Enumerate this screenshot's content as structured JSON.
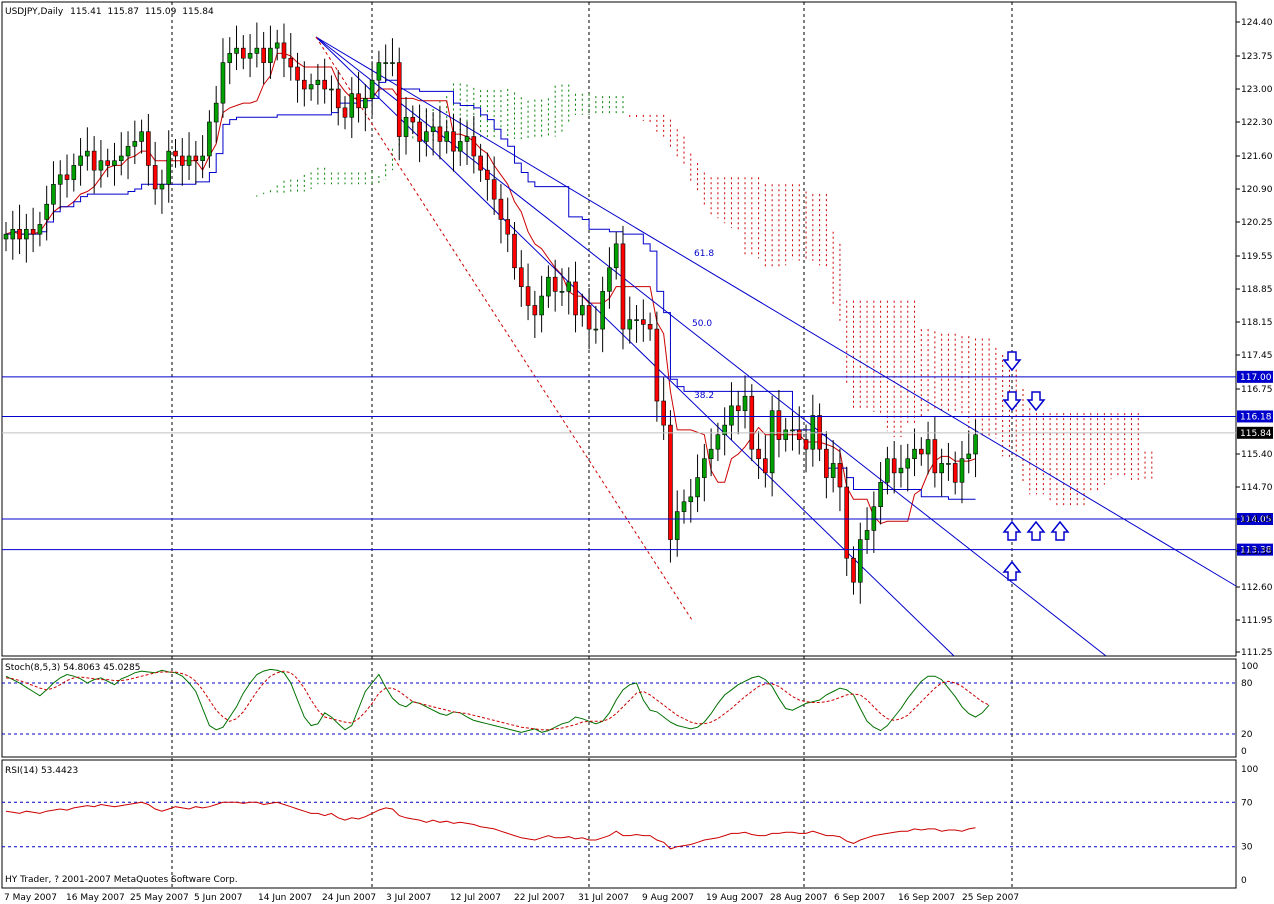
{
  "header": {
    "symbol": "USDJPY,Daily",
    "open": "115.41",
    "high": "115.87",
    "low": "115.09",
    "close": "115.84"
  },
  "colors": {
    "bull": "#00a000",
    "bear": "#ff0000",
    "kijun": "#0000cc",
    "tenkan": "#cc0000",
    "cloud_bear": "#cc0000",
    "cloud_bull": "#008000",
    "level": "#0000cc",
    "price_box": "#000000"
  },
  "chart_data": [
    {
      "type": "candlestick",
      "price_axis": {
        "min": 11.25,
        "max": 124.4,
        "ticks": [
          "124.40",
          "123.75",
          "123.00",
          "122.30",
          "121.60",
          "120.90",
          "120.25",
          "119.55",
          "118.85",
          "118.15",
          "117.45",
          "116.75",
          "115.40",
          "114.70",
          "114.05",
          "113.35",
          "112.60",
          "111.95",
          "111.25"
        ]
      },
      "x_axis_labels": [
        "7 May 2007",
        "16 May 2007",
        "25 May 2007",
        "5 Jun 2007",
        "14 Jun 2007",
        "24 Jun 2007",
        "3 Jul 2007",
        "12 Jul 2007",
        "22 Jul 2007",
        "31 Jul 2007",
        "9 Aug 2007",
        "19 Aug 2007",
        "28 Aug 2007",
        "6 Sep 2007",
        "16 Sep 2007",
        "25 Sep 2007"
      ],
      "levels": [
        {
          "label": "117.00",
          "value": 117.0
        },
        {
          "label": "116.18",
          "value": 116.18
        },
        {
          "label": "114.05",
          "value": 114.05
        },
        {
          "label": "113.38",
          "value": 113.38
        }
      ],
      "current_price": {
        "label": "115.84",
        "value": 115.84
      },
      "fibo_labels": [
        "61.8",
        "50.0",
        "38.2"
      ],
      "closes": [
        120.0,
        120.1,
        119.9,
        120.1,
        120.0,
        120.2,
        120.6,
        121.0,
        121.2,
        121.1,
        121.4,
        121.6,
        121.7,
        121.3,
        121.5,
        121.4,
        121.5,
        121.6,
        121.8,
        121.9,
        122.1,
        121.4,
        120.9,
        121.0,
        121.7,
        121.6,
        121.4,
        121.6,
        121.5,
        121.6,
        122.3,
        122.7,
        123.6,
        123.8,
        123.9,
        123.7,
        123.8,
        123.9,
        123.6,
        123.9,
        124.0,
        123.7,
        123.5,
        123.2,
        123.0,
        123.1,
        123.2,
        123.0,
        123.0,
        122.6,
        122.4,
        122.9,
        122.6,
        122.8,
        123.2,
        123.6,
        123.6,
        123.6,
        122.0,
        122.4,
        122.3,
        121.9,
        122.1,
        122.2,
        121.9,
        122.1,
        121.7,
        121.9,
        122.0,
        121.6,
        121.3,
        121.1,
        120.7,
        120.3,
        120.0,
        119.3,
        118.9,
        118.5,
        118.3,
        118.7,
        119.1,
        118.8,
        118.8,
        119.0,
        118.3,
        118.5,
        118.0,
        118.0,
        118.8,
        119.3,
        119.8,
        118.0,
        118.2,
        118.2,
        118.1,
        118.0,
        116.5,
        116.0,
        113.6,
        114.2,
        114.4,
        114.5,
        114.9,
        115.3,
        115.5,
        115.8,
        116.0,
        116.4,
        116.3,
        116.6,
        115.5,
        115.3,
        115.0,
        116.3,
        115.7,
        115.9,
        115.9,
        115.7,
        115.5,
        116.2,
        115.5,
        114.9,
        115.2,
        114.7,
        113.2,
        112.7,
        113.6,
        113.8,
        114.3,
        114.8,
        115.3,
        115.0,
        115.1,
        115.3,
        115.5,
        115.4,
        115.7,
        115.0,
        115.2,
        115.2,
        114.8,
        115.3,
        115.4,
        115.8
      ],
      "opens": [
        119.9,
        119.9,
        120.1,
        119.9,
        120.1,
        120.0,
        120.3,
        120.6,
        121.0,
        121.2,
        121.1,
        121.4,
        121.6,
        121.7,
        121.3,
        121.5,
        121.4,
        121.5,
        121.6,
        121.8,
        121.9,
        122.1,
        121.4,
        120.9,
        121.0,
        121.7,
        121.6,
        121.4,
        121.6,
        121.5,
        121.6,
        122.3,
        122.7,
        123.6,
        123.8,
        123.9,
        123.7,
        123.8,
        123.9,
        123.6,
        123.9,
        124.0,
        123.7,
        123.5,
        123.2,
        123.0,
        123.1,
        123.2,
        123.0,
        123.0,
        122.6,
        122.4,
        122.9,
        122.6,
        122.8,
        123.2,
        123.6,
        123.6,
        123.6,
        122.0,
        122.4,
        122.3,
        121.9,
        122.1,
        122.2,
        121.9,
        122.1,
        121.7,
        121.9,
        122.0,
        121.6,
        121.3,
        121.1,
        120.7,
        120.3,
        120.0,
        119.3,
        118.9,
        118.5,
        118.3,
        118.7,
        119.1,
        118.8,
        118.8,
        119.0,
        118.3,
        118.5,
        118.0,
        118.0,
        118.8,
        119.3,
        119.8,
        118.0,
        118.2,
        118.2,
        118.1,
        118.0,
        116.5,
        116.0,
        113.6,
        114.2,
        114.4,
        114.5,
        114.9,
        115.3,
        115.5,
        115.8,
        116.0,
        116.4,
        116.3,
        116.6,
        115.5,
        115.3,
        115.0,
        116.3,
        115.7,
        115.9,
        115.9,
        115.7,
        115.5,
        116.2,
        115.5,
        114.9,
        115.2,
        114.7,
        113.2,
        112.7,
        113.6,
        113.8,
        114.3,
        114.8,
        115.3,
        115.0,
        115.1,
        115.3,
        115.5,
        115.4,
        115.7,
        115.0,
        115.2,
        115.2,
        114.8,
        115.3,
        115.4
      ]
    },
    {
      "type": "line",
      "title": "Stoch(8,5,3) 54.8063 45.0285",
      "axis_ticks": [
        "100",
        "80",
        "20",
        "0"
      ],
      "levels": [
        80,
        20
      ],
      "series": [
        {
          "name": "main",
          "values": [
            88,
            84,
            80,
            75,
            70,
            65,
            72,
            80,
            86,
            90,
            88,
            85,
            80,
            84,
            86,
            82,
            78,
            85,
            88,
            92,
            94,
            93,
            92,
            95,
            93,
            92,
            88,
            80,
            70,
            50,
            30,
            25,
            28,
            40,
            52,
            68,
            80,
            90,
            94,
            96,
            95,
            92,
            80,
            60,
            40,
            30,
            32,
            45,
            40,
            32,
            25,
            30,
            50,
            70,
            80,
            90,
            75,
            62,
            55,
            52,
            58,
            56,
            52,
            48,
            44,
            42,
            46,
            45,
            40,
            36,
            34,
            32,
            30,
            28,
            26,
            24,
            22,
            24,
            26,
            22,
            24,
            28,
            32,
            34,
            40,
            38,
            35,
            32,
            35,
            45,
            60,
            72,
            78,
            80,
            60,
            48,
            46,
            40,
            34,
            30,
            28,
            26,
            28,
            34,
            44,
            56,
            66,
            72,
            78,
            82,
            86,
            88,
            84,
            76,
            62,
            50,
            48,
            52,
            56,
            58,
            60,
            66,
            70,
            74,
            72,
            66,
            50,
            35,
            28,
            24,
            30,
            40,
            50,
            62,
            72,
            82,
            88,
            88,
            84,
            74,
            64,
            52,
            44,
            40,
            45,
            54
          ]
        },
        {
          "name": "signal",
          "values": [
            86,
            85,
            83,
            80,
            77,
            74,
            72,
            74,
            78,
            83,
            86,
            87,
            86,
            85,
            84,
            84,
            83,
            83,
            84,
            86,
            88,
            90,
            92,
            93,
            93,
            93,
            91,
            88,
            82,
            72,
            60,
            48,
            40,
            35,
            38,
            46,
            58,
            70,
            80,
            88,
            92,
            94,
            92,
            85,
            74,
            60,
            48,
            40,
            38,
            36,
            34,
            33,
            38,
            46,
            56,
            68,
            74,
            74,
            70,
            64,
            58,
            56,
            54,
            52,
            50,
            48,
            46,
            45,
            44,
            42,
            40,
            38,
            36,
            34,
            32,
            30,
            28,
            27,
            26,
            25,
            25,
            26,
            27,
            29,
            31,
            34,
            35,
            35,
            35,
            38,
            44,
            52,
            60,
            68,
            70,
            66,
            60,
            54,
            48,
            42,
            38,
            34,
            32,
            32,
            34,
            38,
            44,
            50,
            57,
            64,
            70,
            76,
            79,
            79,
            76,
            70,
            64,
            60,
            58,
            57,
            57,
            58,
            60,
            63,
            66,
            67,
            66,
            60,
            52,
            44,
            38,
            36,
            38,
            42,
            50,
            58,
            66,
            74,
            80,
            82,
            80,
            76,
            70,
            64,
            58,
            54
          ]
        }
      ]
    },
    {
      "type": "line",
      "title": "RSI(14) 53.4423",
      "axis_ticks": [
        "100",
        "70",
        "30",
        "0"
      ],
      "levels": [
        70,
        30
      ],
      "series": [
        {
          "name": "RSI",
          "values": [
            62,
            61,
            60,
            62,
            61,
            60,
            62,
            63,
            64,
            63,
            65,
            66,
            67,
            66,
            68,
            67,
            66,
            67,
            68,
            69,
            70,
            68,
            64,
            62,
            64,
            66,
            65,
            64,
            66,
            65,
            66,
            68,
            70,
            70,
            70,
            69,
            70,
            70,
            68,
            69,
            70,
            68,
            66,
            64,
            62,
            60,
            60,
            58,
            60,
            56,
            54,
            56,
            55,
            57,
            60,
            63,
            65,
            64,
            58,
            56,
            55,
            54,
            52,
            54,
            52,
            53,
            51,
            52,
            51,
            50,
            48,
            47,
            46,
            44,
            42,
            40,
            38,
            37,
            36,
            38,
            40,
            38,
            38,
            39,
            37,
            38,
            36,
            36,
            38,
            40,
            44,
            40,
            40,
            41,
            40,
            40,
            36,
            34,
            28,
            30,
            31,
            32,
            34,
            36,
            37,
            38,
            40,
            42,
            42,
            43,
            41,
            40,
            40,
            42,
            42,
            43,
            43,
            42,
            42,
            44,
            42,
            40,
            40,
            39,
            35,
            33,
            36,
            38,
            40,
            41,
            42,
            43,
            44,
            44,
            46,
            45,
            46,
            46,
            44,
            45,
            45,
            44,
            46,
            47
          ]
        }
      ]
    }
  ],
  "footer": {
    "copyright": "HY Trader, ? 2001-2007 MetaQuotes Software Corp."
  }
}
